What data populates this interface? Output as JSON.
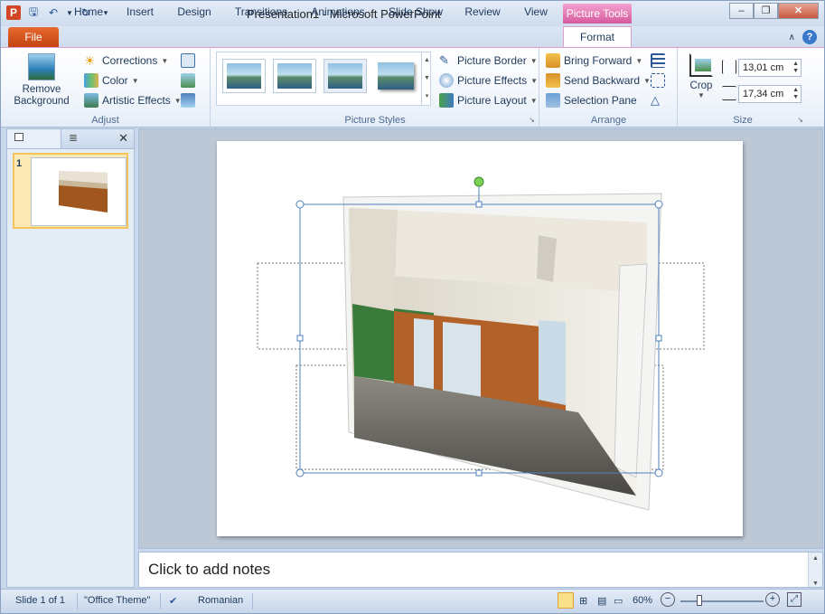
{
  "app": {
    "title": "Presentation1 - Microsoft PowerPoint",
    "context_tab": "Picture Tools"
  },
  "tabs": {
    "file": "File",
    "home": "Home",
    "insert": "Insert",
    "design": "Design",
    "transitions": "Transitions",
    "animations": "Animations",
    "slideshow": "Slide Show",
    "review": "Review",
    "view": "View",
    "format": "Format"
  },
  "ribbon": {
    "adjust": {
      "remove_bg": "Remove Background",
      "corrections": "Corrections",
      "color": "Color",
      "artistic": "Artistic Effects",
      "label": "Adjust"
    },
    "styles": {
      "label": "Picture Styles",
      "border": "Picture Border",
      "effects": "Picture Effects",
      "layout": "Picture Layout"
    },
    "arrange": {
      "label": "Arrange",
      "forward": "Bring Forward",
      "backward": "Send Backward",
      "selection": "Selection Pane"
    },
    "size": {
      "label": "Size",
      "crop": "Crop",
      "height": "13,01 cm",
      "width": "17,34 cm"
    }
  },
  "slides_pane": {
    "slide_number": "1"
  },
  "notes": {
    "placeholder": "Click to add notes"
  },
  "status": {
    "slide": "Slide 1 of 1",
    "theme": "\"Office Theme\"",
    "language": "Romanian",
    "zoom": "60%"
  },
  "colors": {
    "accent_file": "#d04a18",
    "context_pink": "#d6599e",
    "selection": "#4f81bd"
  }
}
